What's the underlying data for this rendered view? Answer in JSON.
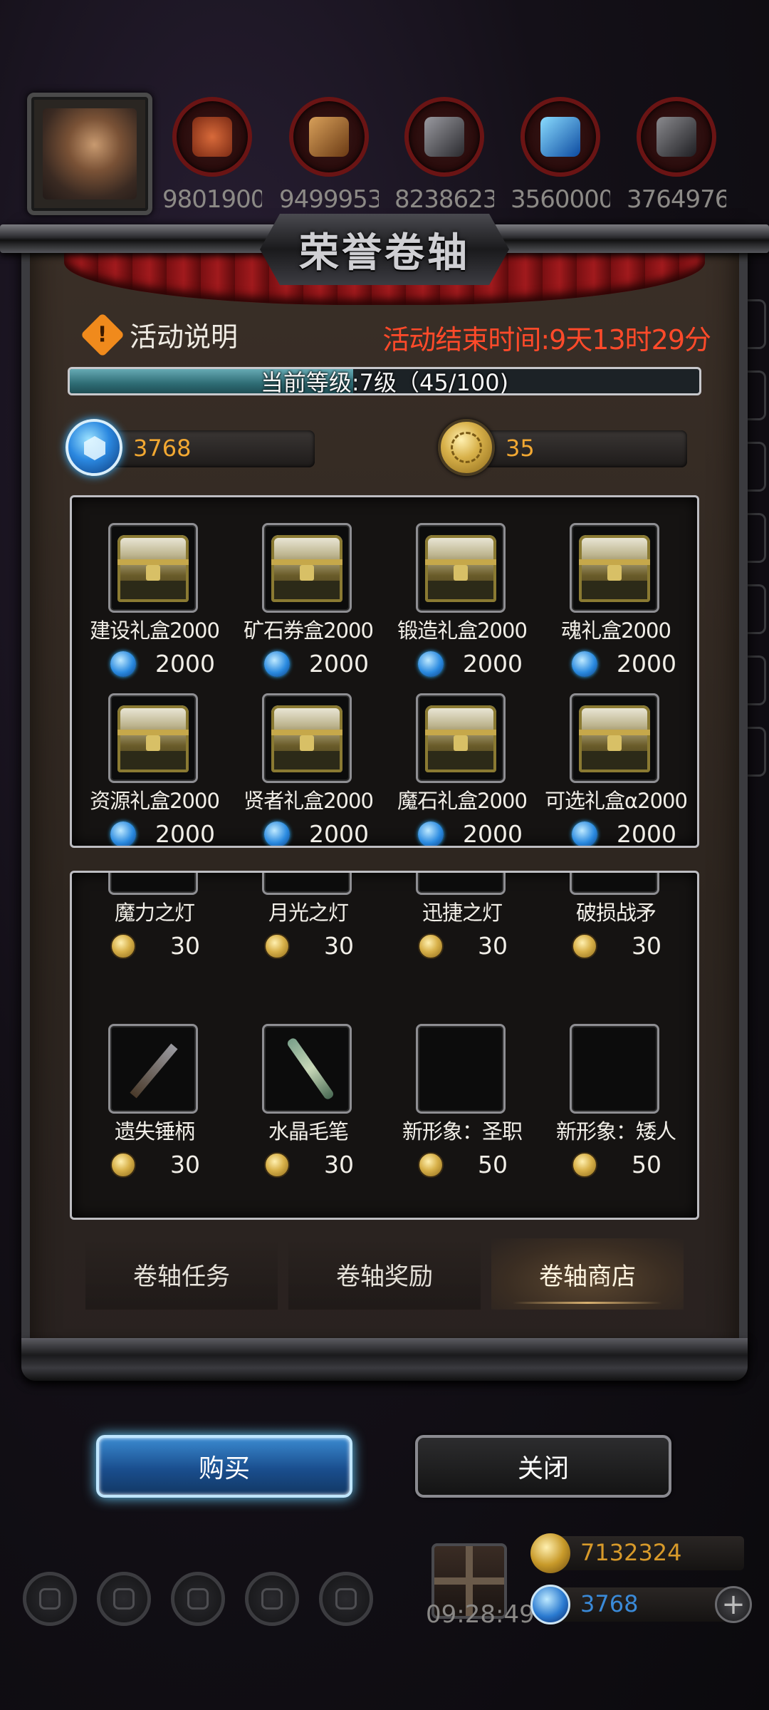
{
  "top_resources": [
    {
      "icon": "meat-icon",
      "value": "9801900",
      "color": "#c0592a"
    },
    {
      "icon": "wood-icon",
      "value": "9499953",
      "color": "#b07a3a"
    },
    {
      "icon": "iron-ingot-icon",
      "value": "8238623",
      "color": "#6a6a6e"
    },
    {
      "icon": "crystal-icon",
      "value": "3560000",
      "color": "#2a90e0"
    },
    {
      "icon": "steel-icon",
      "value": "3764976",
      "color": "#5a5a5e"
    }
  ],
  "dialog": {
    "title": "荣誉卷轴",
    "activity_desc": "活动说明",
    "end_time": "活动结束时间:9天13时29分",
    "level_text": "当前等级:7级（45/100)",
    "level_progress": 0.45,
    "gem_balance": "3768",
    "coin_balance": "35"
  },
  "gem_shop": [
    {
      "name": "建设礼盒2000",
      "price": "2000"
    },
    {
      "name": "矿石券盒2000",
      "price": "2000"
    },
    {
      "name": "锻造礼盒2000",
      "price": "2000"
    },
    {
      "name": "魂礼盒2000",
      "price": "2000"
    },
    {
      "name": "资源礼盒2000",
      "price": "2000"
    },
    {
      "name": "贤者礼盒2000",
      "price": "2000"
    },
    {
      "name": "魔石礼盒2000",
      "price": "2000"
    },
    {
      "name": "可选礼盒α2000",
      "price": "2000"
    }
  ],
  "coin_shop": [
    {
      "name": "魔力之灯",
      "price": "30",
      "art": "art-lamp-blue"
    },
    {
      "name": "月光之灯",
      "price": "30",
      "art": "art-lamp-green"
    },
    {
      "name": "迅捷之灯",
      "price": "30",
      "art": "art-lamp-teal"
    },
    {
      "name": "破损战矛",
      "price": "30",
      "art": "art-spear"
    },
    {
      "name": "遗失锤柄",
      "price": "30",
      "art": "art-hammer"
    },
    {
      "name": "水晶毛笔",
      "price": "30",
      "art": "art-brush"
    },
    {
      "name": "新形象：圣职",
      "price": "50",
      "art": "art-priest"
    },
    {
      "name": "新形象：矮人",
      "price": "50",
      "art": "art-dwarf"
    }
  ],
  "tabs": [
    {
      "label": "卷轴任务",
      "active": false
    },
    {
      "label": "卷轴奖励",
      "active": false
    },
    {
      "label": "卷轴商店",
      "active": true
    }
  ],
  "buttons": {
    "buy": "购买",
    "close": "关闭"
  },
  "hud": {
    "timer": "09:28:49",
    "gold": "7132324",
    "gems": "3768",
    "gold_color": "#d89a2a",
    "gem_color": "#3a8ad8"
  }
}
